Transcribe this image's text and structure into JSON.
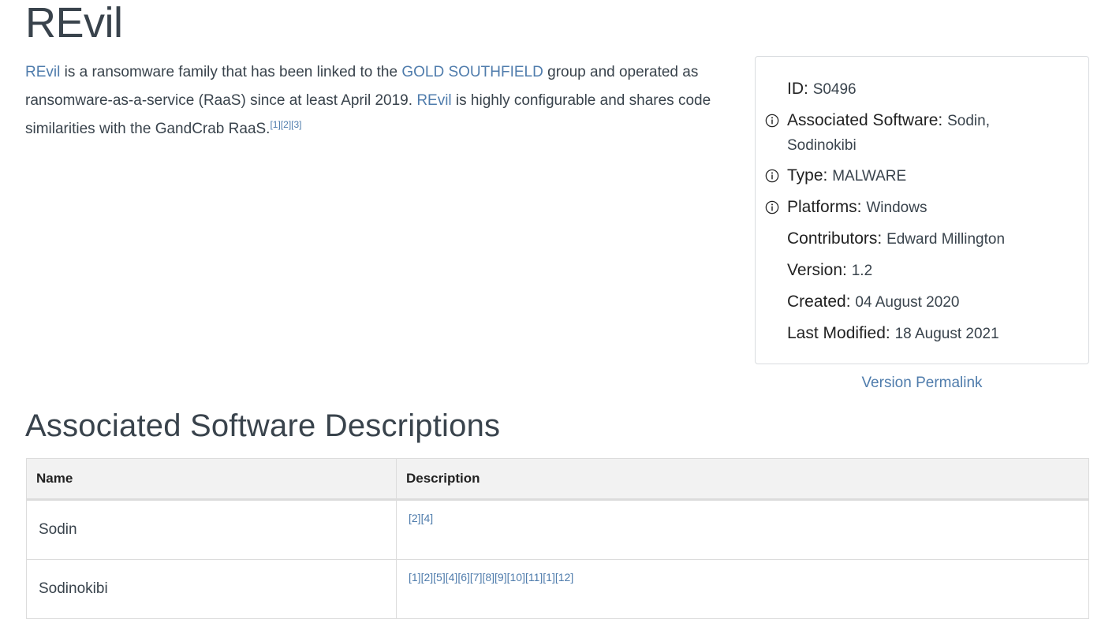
{
  "page": {
    "title": "REvil"
  },
  "description": {
    "link1": "REvil",
    "text1": " is a ransomware family that has been linked to the ",
    "link2": "GOLD SOUTHFIELD",
    "text2": " group and operated as ransomware-as-a-service (RaaS) since at least April 2019. ",
    "link3": "REvil",
    "text3": " is highly configurable and shares code similarities with the GandCrab RaaS.",
    "refs": [
      "[1]",
      "[2]",
      "[3]"
    ]
  },
  "card": {
    "id_label": "ID:",
    "id_value": "S0496",
    "assoc_label": "Associated Software:",
    "assoc_value": "Sodin,",
    "assoc_value2": "Sodinokibi",
    "type_label": "Type:",
    "type_value": "MALWARE",
    "platforms_label": "Platforms:",
    "platforms_value": "Windows",
    "contributors_label": "Contributors:",
    "contributors_value": "Edward Millington",
    "version_label": "Version:",
    "version_value": "1.2",
    "created_label": "Created:",
    "created_value": "04 August 2020",
    "modified_label": "Last Modified:",
    "modified_value": "18 August 2021"
  },
  "permalink": "Version Permalink",
  "assoc_section": {
    "heading": "Associated Software Descriptions",
    "col_name": "Name",
    "col_desc": "Description",
    "rows": [
      {
        "name": "Sodin",
        "refs": [
          "[2]",
          "[4]"
        ]
      },
      {
        "name": "Sodinokibi",
        "refs": [
          "[1]",
          "[2]",
          "[5]",
          "[4]",
          "[6]",
          "[7]",
          "[8]",
          "[9]",
          "[10]",
          "[11]",
          "[1]",
          "[12]"
        ]
      }
    ]
  },
  "colors": {
    "link": "#4f7cac",
    "text": "#39434c",
    "header_bg": "#f2f2f2"
  },
  "icons": {
    "info": "info-circle-icon"
  }
}
